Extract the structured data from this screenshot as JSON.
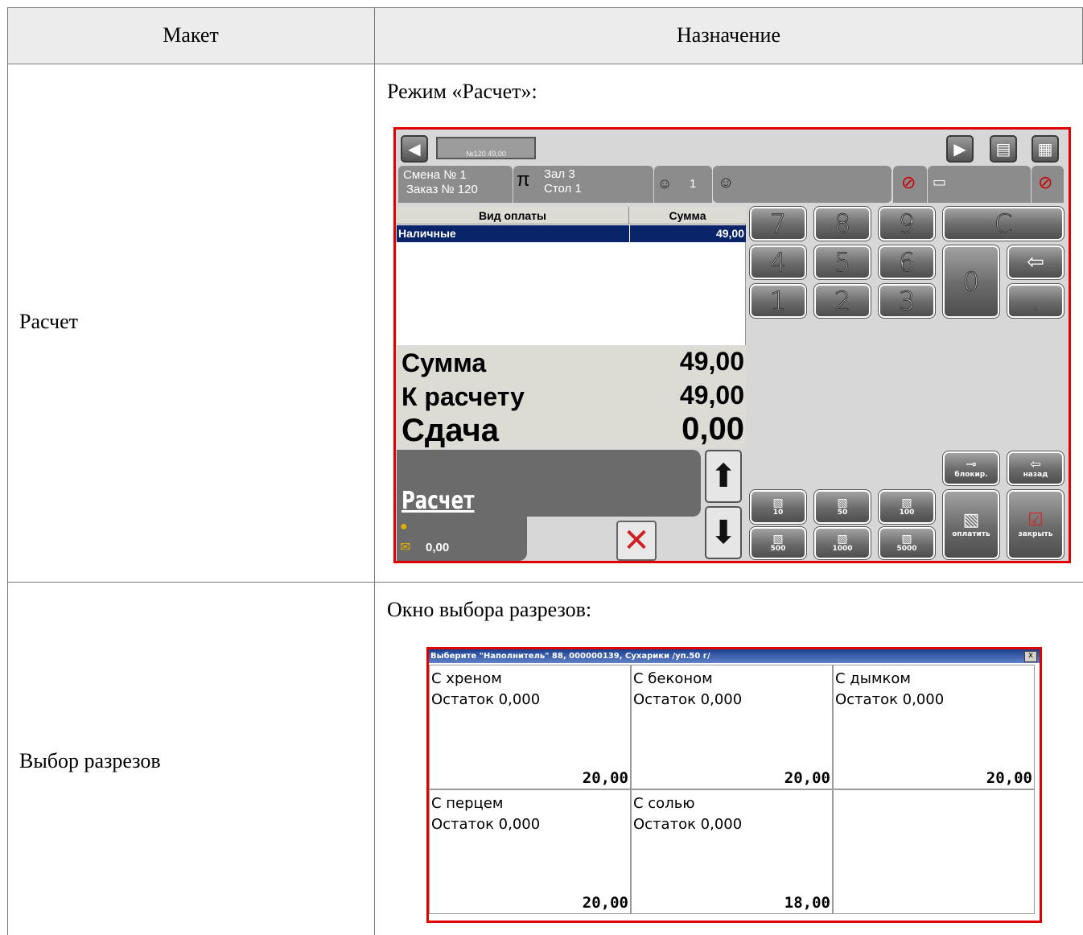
{
  "table": {
    "headers": [
      "Макет",
      "Назначение"
    ],
    "rows": [
      {
        "layout": "Расчет",
        "purpose_caption": "Режим «Расчет»:"
      },
      {
        "layout": "Выбор разрезов",
        "purpose_caption": "Окно выбора разрезов:"
      }
    ]
  },
  "pos": {
    "order_field": "№120   49,00",
    "shift": "Смена № 1",
    "order": "Заказ № 120",
    "hall": "Зал 3",
    "table": "Стол 1",
    "guests": "1",
    "payment_table": {
      "headers": [
        "Вид оплаты",
        "Сумма"
      ],
      "rows": [
        {
          "type": "Наличные",
          "amount": "49,00"
        }
      ]
    },
    "totals": [
      {
        "label": "Сумма",
        "value": "49,00"
      },
      {
        "label": "К расчету",
        "value": "49,00"
      },
      {
        "label": "Сдача",
        "value": "0,00"
      }
    ],
    "mode_label": "Расчет",
    "bonus_value": "0,00",
    "keypad": {
      "clear": "C",
      "zero": "0",
      "dot": ".",
      "row1": [
        "7",
        "8",
        "9"
      ],
      "row2": [
        "4",
        "5",
        "6"
      ],
      "row3": [
        "1",
        "2",
        "3"
      ]
    },
    "banknotes_top": [
      "10",
      "50",
      "100"
    ],
    "banknotes_bottom": [
      "500",
      "1000",
      "5000"
    ],
    "block_label": "блокир.",
    "back_label": "назад",
    "pay_label": "оплатить",
    "close_label": "закрыть"
  },
  "cuts": {
    "title": "Выберите \"Наполнитель\" 88, 000000139, Сухарики /уп.50 г/",
    "close": "x",
    "items": [
      {
        "name": "С хреном",
        "remainder": "Остаток 0,000",
        "price": "20,00"
      },
      {
        "name": "С беконом",
        "remainder": "Остаток 0,000",
        "price": "20,00"
      },
      {
        "name": "С дымком",
        "remainder": "Остаток 0,000",
        "price": "20,00"
      },
      {
        "name": "С перцем",
        "remainder": "Остаток 0,000",
        "price": "20,00"
      },
      {
        "name": "С солью",
        "remainder": "Остаток 0,000",
        "price": "18,00"
      }
    ]
  }
}
